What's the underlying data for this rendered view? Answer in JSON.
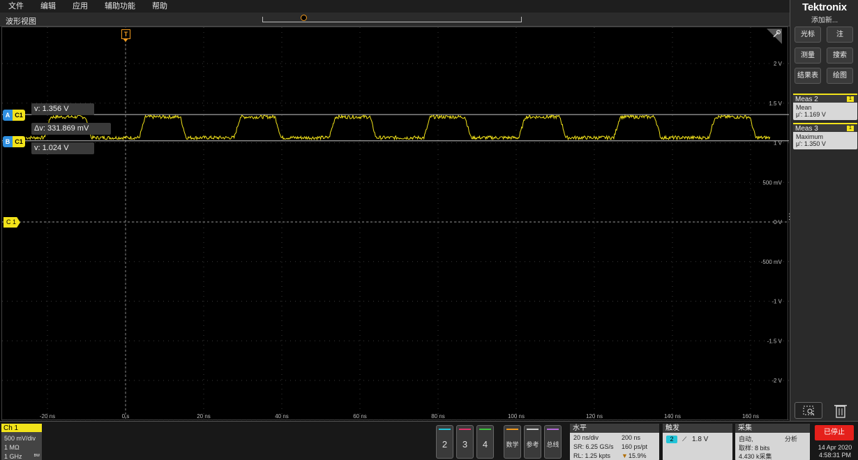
{
  "menu": [
    "文件",
    "编辑",
    "应用",
    "辅助功能",
    "帮助"
  ],
  "waveform_view": {
    "title": "波形视图",
    "trigger_marker": "T",
    "overview_marker": "T"
  },
  "plot": {
    "y_ticks": [
      {
        "label": "2 V",
        "value": 2
      },
      {
        "label": "1.5 V",
        "value": 1.5
      },
      {
        "label": "1 V",
        "value": 1
      },
      {
        "label": "500 mV",
        "value": 0.5
      },
      {
        "label": "0 V",
        "value": 0
      },
      {
        "label": "-500 mV",
        "value": -0.5
      },
      {
        "label": "-1 V",
        "value": -1
      },
      {
        "label": "-1.5 V",
        "value": -1.5
      },
      {
        "label": "-2 V",
        "value": -2
      }
    ],
    "x_ticks": [
      {
        "label": "-20 ns",
        "value": -20
      },
      {
        "label": "0 s",
        "value": 0
      },
      {
        "label": "20 ns",
        "value": 20
      },
      {
        "label": "40 ns",
        "value": 40
      },
      {
        "label": "60 ns",
        "value": 60
      },
      {
        "label": "80 ns",
        "value": 80
      },
      {
        "label": "100 ns",
        "value": 100
      },
      {
        "label": "120 ns",
        "value": 120
      },
      {
        "label": "140 ns",
        "value": 140
      },
      {
        "label": "160 ns",
        "value": 160
      }
    ],
    "channel_marker": "C 1",
    "trace_color": "#f2e31a",
    "cursor_color": "#c9c9c9",
    "accent_trigger": "#f39b1f"
  },
  "cursors": {
    "a": {
      "id": "A",
      "channel": "C1",
      "readout": "v: 1.356 V",
      "value": 1.356
    },
    "b": {
      "id": "B",
      "channel": "C1",
      "readout": "v: 1.024 V",
      "value": 1.024
    },
    "delta": "Δv: 331.869 mV"
  },
  "sidebar": {
    "brand": "Tektronix",
    "add_new": "添加新...",
    "buttons": [
      "光标",
      "注",
      "测量",
      "搜索",
      "结果表",
      "绘图"
    ],
    "meas": [
      {
        "title": "Meas 2",
        "badge": "1",
        "name": "Mean",
        "value": "μ': 1.169 V"
      },
      {
        "title": "Meas 3",
        "badge": "1",
        "name": "Maximum",
        "value": "μ': 1.350 V"
      }
    ]
  },
  "status": {
    "ch1": {
      "title": "Ch 1",
      "scale": "500 mV/div",
      "impedance": "1 MΩ",
      "bandwidth": "1 GHz"
    },
    "channel_buttons": [
      {
        "label": "2",
        "color": "#22c4d8"
      },
      {
        "label": "3",
        "color": "#e0336a"
      },
      {
        "label": "4",
        "color": "#3ec43e"
      },
      {
        "label": "数学",
        "color": "#f39b1f"
      },
      {
        "label": "参考",
        "color": "#cccccc"
      },
      {
        "label": "总线",
        "color": "#b36ad8"
      }
    ],
    "horizontal": {
      "title": "水平",
      "scale": "20 ns/div",
      "position": "200 ns",
      "sample_rate": "SR: 6.25 GS/s",
      "resolution": "160 ps/pt",
      "record_length": "RL: 1.25 kpts",
      "trigger_pos": "15.9%"
    },
    "trigger": {
      "title": "触发",
      "source": "2",
      "level": "1.8 V"
    },
    "acquisition": {
      "title": "采集",
      "mode": "自动,",
      "analyze": "分析",
      "sampling": "取样: 8 bits",
      "acq_count": "4.430 k采集"
    },
    "run_state": "已停止",
    "date": "14 Apr 2020",
    "time": "4:58:31 PM"
  }
}
